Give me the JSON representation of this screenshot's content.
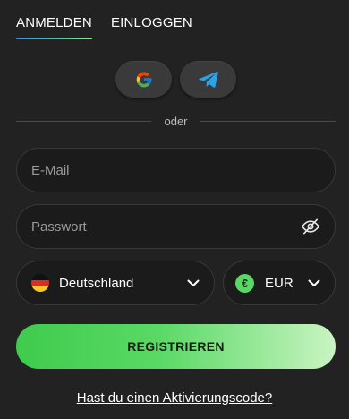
{
  "tabs": [
    {
      "label": "ANMELDEN",
      "active": true
    },
    {
      "label": "EINLOGGEN",
      "active": false
    }
  ],
  "social": {
    "google_icon": "google-icon",
    "telegram_icon": "telegram-icon"
  },
  "divider_text": "oder",
  "email": {
    "placeholder": "E-Mail",
    "value": ""
  },
  "password": {
    "placeholder": "Passwort",
    "value": "",
    "toggle_icon": "eye-slash-icon"
  },
  "country": {
    "label": "Deutschland",
    "flag_icon": "germany-flag-icon"
  },
  "currency": {
    "label": "EUR",
    "symbol": "€"
  },
  "register_label": "REGISTRIEREN",
  "activation_link": "Hast du einen Aktivierungscode?",
  "colors": {
    "background": "#222222",
    "accent_green": "#57d964",
    "field_bg": "#1b1b1b",
    "telegram_blue": "#2aa3e8"
  }
}
